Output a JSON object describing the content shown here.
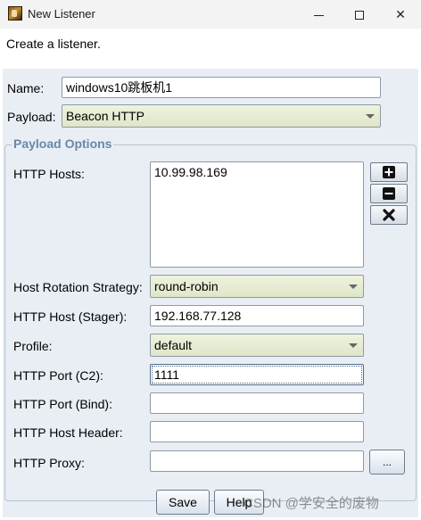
{
  "window": {
    "title": "New Listener",
    "controls": {
      "minimize": "minimize",
      "maximize": "maximize",
      "close": "✕"
    }
  },
  "description": "Create a listener.",
  "form": {
    "name_label": "Name:",
    "name_value": "windows10跳板机1",
    "payload_label": "Payload:",
    "payload_value": "Beacon HTTP"
  },
  "payload_options": {
    "legend": "Payload Options",
    "http_hosts_label": "HTTP Hosts:",
    "http_hosts": [
      "10.99.98.169"
    ],
    "host_rotation_label": "Host Rotation Strategy:",
    "host_rotation_value": "round-robin",
    "http_host_stager_label": "HTTP Host (Stager):",
    "http_host_stager_value": "192.168.77.128",
    "profile_label": "Profile:",
    "profile_value": "default",
    "http_port_c2_label": "HTTP Port (C2):",
    "http_port_c2_value": "1111",
    "http_port_bind_label": "HTTP Port (Bind):",
    "http_port_bind_value": "",
    "http_host_header_label": "HTTP Host Header:",
    "http_host_header_value": "",
    "http_proxy_label": "HTTP Proxy:",
    "http_proxy_value": "",
    "proxy_browse_label": "..."
  },
  "buttons": {
    "save": "Save",
    "help": "Help"
  },
  "watermark": "CSDN @学安全的废物"
}
